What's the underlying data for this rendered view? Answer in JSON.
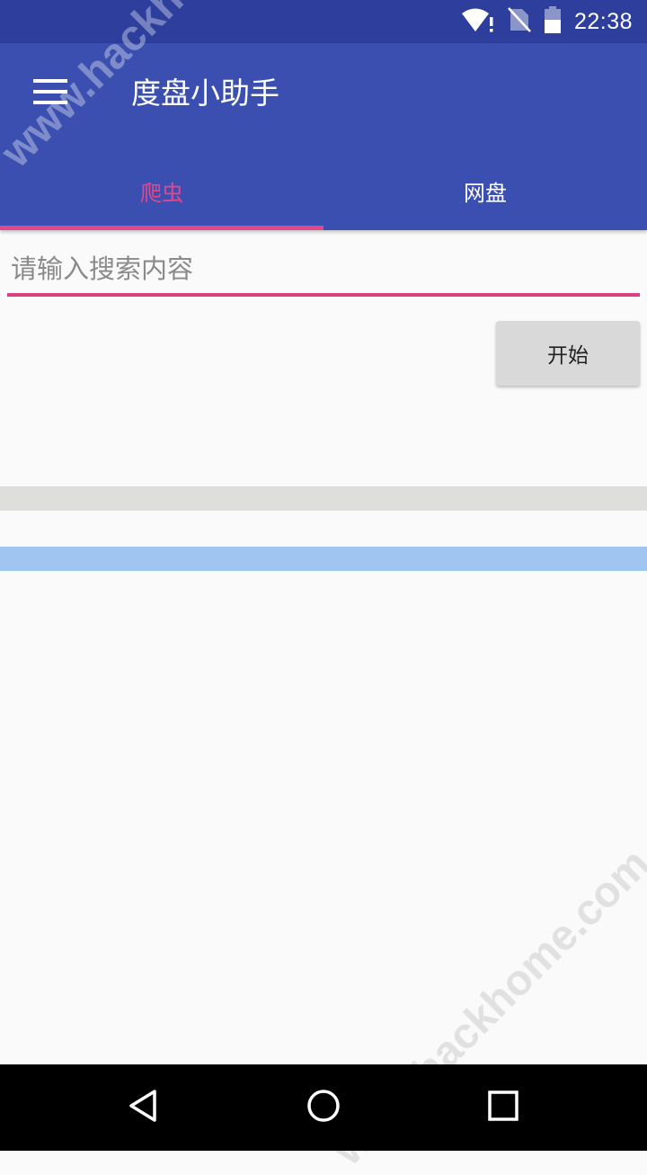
{
  "status_bar": {
    "time": "22:38",
    "icons": [
      "wifi-alert-icon",
      "no-sim-icon",
      "battery-icon"
    ]
  },
  "app_bar": {
    "title": "度盘小助手",
    "menu_icon": "menu-icon"
  },
  "tabs": [
    {
      "label": "爬虫",
      "selected": true
    },
    {
      "label": "网盘",
      "selected": false
    }
  ],
  "search": {
    "placeholder": "请输入搜索内容",
    "value": ""
  },
  "start_button": {
    "label": "开始"
  },
  "nav_bar": {
    "icons": [
      "back-icon",
      "home-icon",
      "recents-icon"
    ]
  },
  "watermark": "www.hackhome.com",
  "colors": {
    "status_bar": "#2d3e9d",
    "app_bar": "#3b4fb1",
    "accent": "#e5478b",
    "divider_gray": "#dededb",
    "divider_blue": "#9fc5f0"
  }
}
